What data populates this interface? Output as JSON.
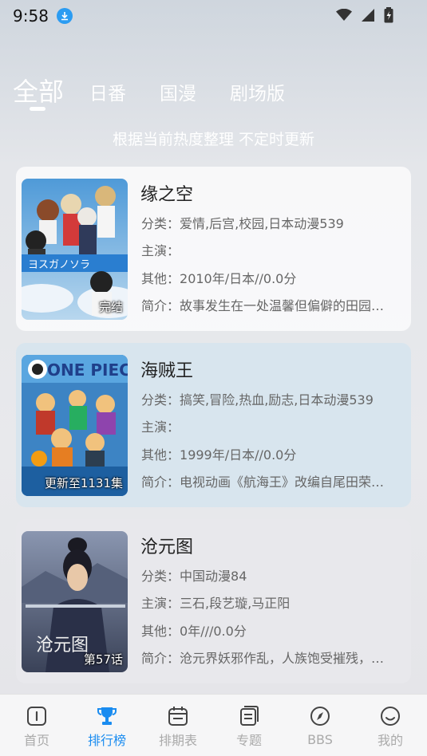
{
  "status": {
    "time": "9:58"
  },
  "tabs": {
    "all": "全部",
    "jp": "日番",
    "cn": "国漫",
    "movie": "剧场版"
  },
  "subtitle": "根据当前热度整理 不定时更新",
  "labels": {
    "category": "分类：",
    "cast": "主演：",
    "other": "其他：",
    "intro": "简介："
  },
  "items": [
    {
      "title": "缘之空",
      "badge": "完结",
      "category": "爱情,后宫,校园,日本动漫539",
      "cast": "",
      "other": "2010年/日本//0.0分",
      "intro": "故事发生在一处温馨但偏僻的田园…"
    },
    {
      "title": "海贼王",
      "badge": "更新至1131集",
      "category": "搞笑,冒险,热血,励志,日本动漫539",
      "cast": "",
      "other": "1999年/日本//0.0分",
      "intro": "电视动画《航海王》改编自尾田荣…"
    },
    {
      "title": "沧元图",
      "badge": "第57话",
      "category": "中国动漫84",
      "cast": "三石,段艺璇,马正阳",
      "other": "0年///0.0分",
      "intro": "沧元界妖邪作乱，人族饱受摧残，…"
    }
  ],
  "nav": [
    {
      "label": "首页",
      "icon": "home-icon"
    },
    {
      "label": "排行榜",
      "icon": "trophy-icon"
    },
    {
      "label": "排期表",
      "icon": "calendar-icon"
    },
    {
      "label": "专题",
      "icon": "topic-icon"
    },
    {
      "label": "BBS",
      "icon": "compass-icon"
    },
    {
      "label": "我的",
      "icon": "profile-icon"
    }
  ],
  "colors": {
    "accent": "#1a8cf0",
    "download": "#2b9cf2"
  }
}
